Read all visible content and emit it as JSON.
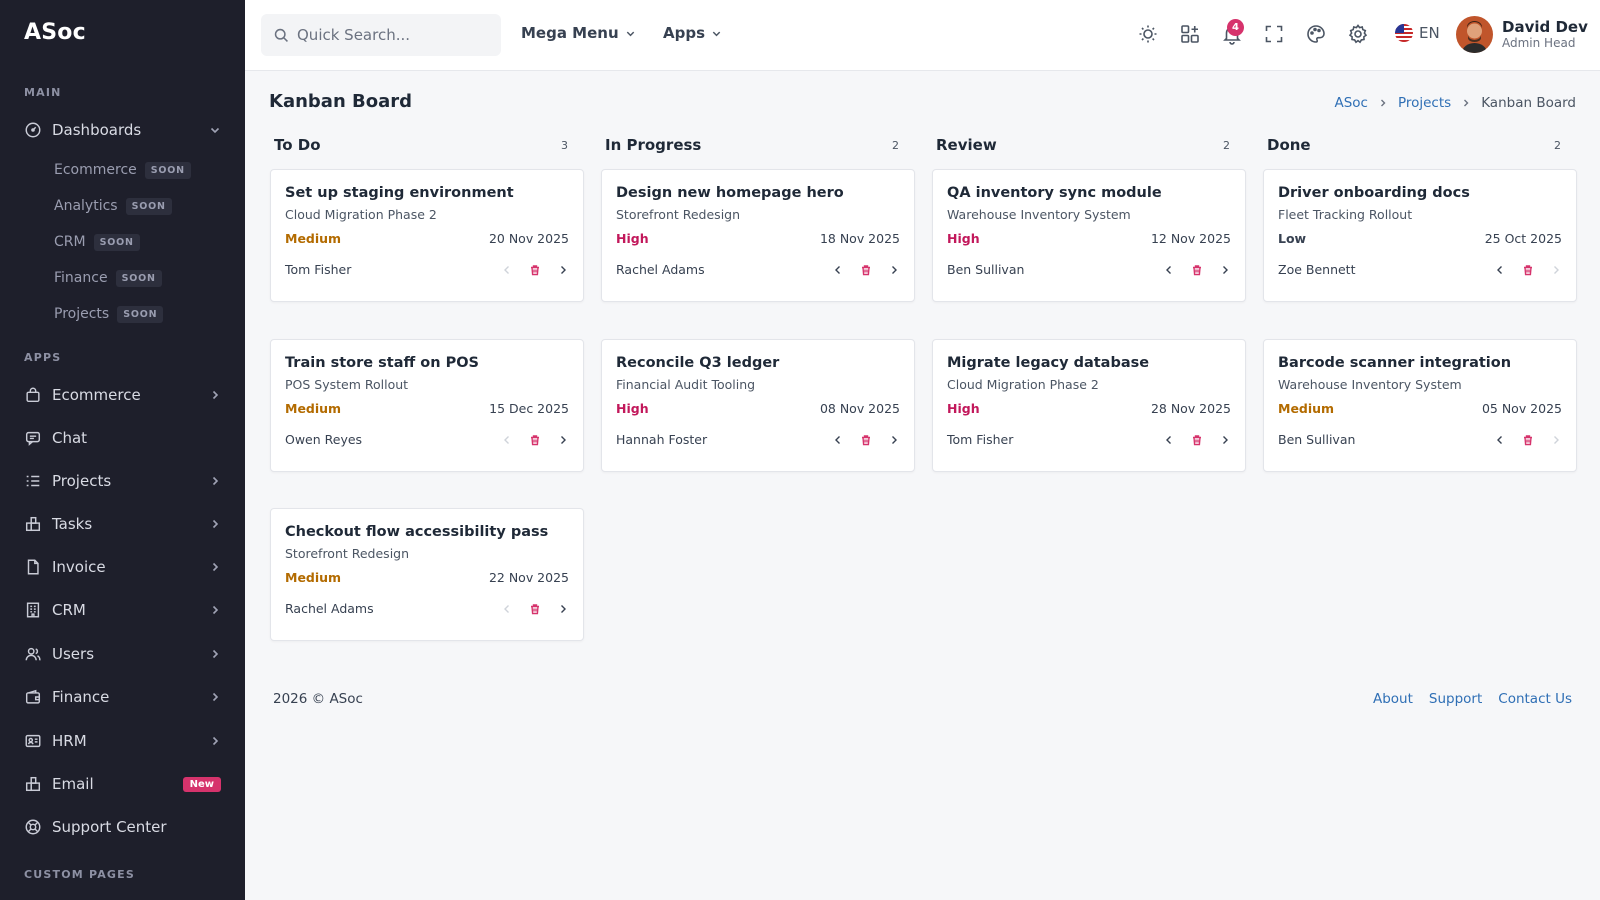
{
  "app": {
    "brand": "ASoc"
  },
  "sidebar": {
    "sections": {
      "main": "MAIN",
      "apps": "APPS",
      "custom": "CUSTOM PAGES"
    },
    "dashboards": {
      "label": "Dashboards",
      "children": [
        {
          "label": "Ecommerce",
          "badge": "SOON"
        },
        {
          "label": "Analytics",
          "badge": "SOON"
        },
        {
          "label": "CRM",
          "badge": "SOON"
        },
        {
          "label": "Finance",
          "badge": "SOON"
        },
        {
          "label": "Projects",
          "badge": "SOON"
        }
      ]
    },
    "items": [
      {
        "label": "Ecommerce",
        "icon": "shopping-bag-icon"
      },
      {
        "label": "Chat",
        "icon": "chat-icon"
      },
      {
        "label": "Projects",
        "icon": "list-icon"
      },
      {
        "label": "Tasks",
        "icon": "tasks-icon"
      },
      {
        "label": "Invoice",
        "icon": "file-icon"
      },
      {
        "label": "CRM",
        "icon": "building-icon"
      },
      {
        "label": "Users",
        "icon": "users-icon"
      },
      {
        "label": "Finance",
        "icon": "wallet-icon"
      },
      {
        "label": "HRM",
        "icon": "id-card-icon"
      },
      {
        "label": "Email",
        "icon": "email-icon",
        "badge": "New"
      },
      {
        "label": "Support Center",
        "icon": "lifebuoy-icon"
      }
    ]
  },
  "header": {
    "search_placeholder": "Quick Search...",
    "mega_menu": "Mega Menu",
    "apps": "Apps",
    "notification_count": "4",
    "language": "EN",
    "user": {
      "name": "David Dev",
      "role": "Admin Head"
    }
  },
  "page": {
    "title": "Kanban Board",
    "breadcrumb": [
      "ASoc",
      "Projects",
      "Kanban Board"
    ]
  },
  "board": {
    "columns": [
      {
        "title": "To Do",
        "count": "3",
        "cards": [
          {
            "title": "Set up staging environment",
            "project": "Cloud Migration Phase 2",
            "priority": "Medium",
            "date": "20 Nov 2025",
            "assignee": "Tom Fisher"
          },
          {
            "title": "Train store staff on POS",
            "project": "POS System Rollout",
            "priority": "Medium",
            "date": "15 Dec 2025",
            "assignee": "Owen Reyes"
          },
          {
            "title": "Checkout flow accessibility pass",
            "project": "Storefront Redesign",
            "priority": "Medium",
            "date": "22 Nov 2025",
            "assignee": "Rachel Adams"
          }
        ]
      },
      {
        "title": "In Progress",
        "count": "2",
        "cards": [
          {
            "title": "Design new homepage hero",
            "project": "Storefront Redesign",
            "priority": "High",
            "date": "18 Nov 2025",
            "assignee": "Rachel Adams"
          },
          {
            "title": "Reconcile Q3 ledger",
            "project": "Financial Audit Tooling",
            "priority": "High",
            "date": "08 Nov 2025",
            "assignee": "Hannah Foster"
          }
        ]
      },
      {
        "title": "Review",
        "count": "2",
        "cards": [
          {
            "title": "QA inventory sync module",
            "project": "Warehouse Inventory System",
            "priority": "High",
            "date": "12 Nov 2025",
            "assignee": "Ben Sullivan"
          },
          {
            "title": "Migrate legacy database",
            "project": "Cloud Migration Phase 2",
            "priority": "High",
            "date": "28 Nov 2025",
            "assignee": "Tom Fisher"
          }
        ]
      },
      {
        "title": "Done",
        "count": "2",
        "cards": [
          {
            "title": "Driver onboarding docs",
            "project": "Fleet Tracking Rollout",
            "priority": "Low",
            "date": "25 Oct 2025",
            "assignee": "Zoe Bennett"
          },
          {
            "title": "Barcode scanner integration",
            "project": "Warehouse Inventory System",
            "priority": "Medium",
            "date": "05 Nov 2025",
            "assignee": "Ben Sullivan"
          }
        ]
      }
    ]
  },
  "footer": {
    "copyright": "2026 © ASoc",
    "links": [
      "About",
      "Support",
      "Contact Us"
    ]
  },
  "colors": {
    "sidebar_bg": "#1e1f2b",
    "accent_pink": "#d6336c",
    "link_blue": "#2f6fb5",
    "medium": "#b36b00",
    "high": "#c2185b"
  }
}
